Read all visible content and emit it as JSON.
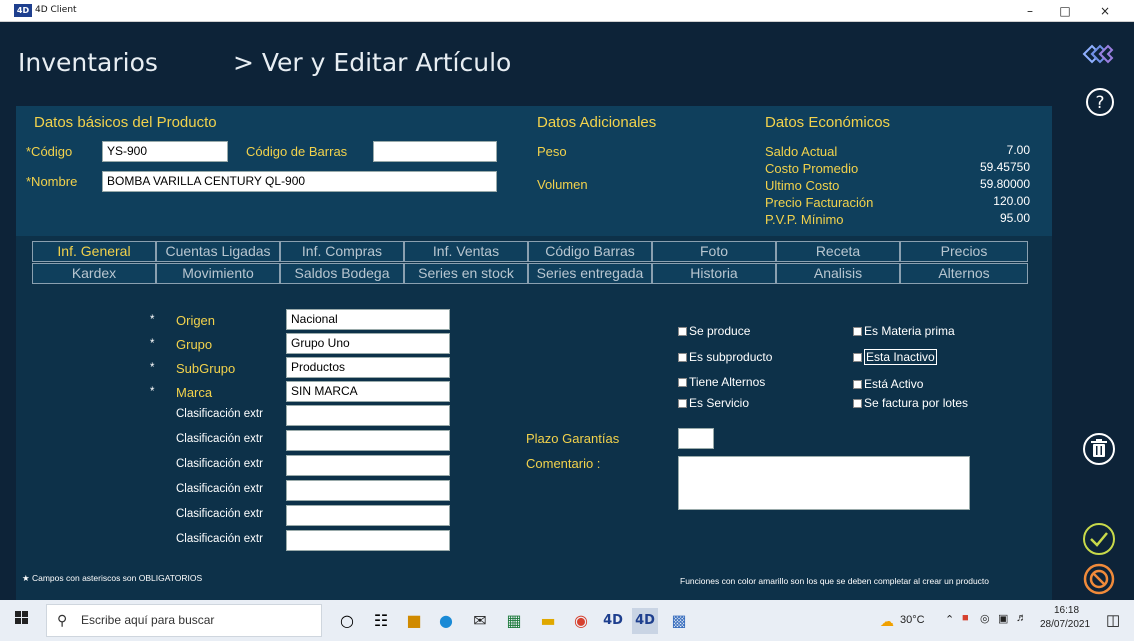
{
  "window": {
    "title": "4D Client",
    "icon_label": "4D"
  },
  "header": {
    "module": "Inventarios",
    "subtitle": "> Ver y Editar Artículo"
  },
  "basic": {
    "section_title": "Datos básicos del Producto",
    "codigo_label": "*Código",
    "codigo_value": "YS-900",
    "barras_label": "Código de Barras",
    "barras_value": "",
    "nombre_label": "*Nombre",
    "nombre_value": "BOMBA VARILLA CENTURY QL-900"
  },
  "additional": {
    "section_title": "Datos Adicionales",
    "peso_label": "Peso",
    "volumen_label": "Volumen"
  },
  "economic": {
    "section_title": "Datos Económicos",
    "rows": [
      {
        "label": "Saldo Actual",
        "value": "7.00"
      },
      {
        "label": "Costo Promedio",
        "value": "59.45750"
      },
      {
        "label": "Ultimo Costo",
        "value": "59.80000"
      },
      {
        "label": "Precio Facturación",
        "value": "120.00"
      },
      {
        "label": "P.V.P. Mínimo",
        "value": "95.00"
      }
    ]
  },
  "tabs_row1": [
    "Inf. General",
    "Cuentas Ligadas",
    "Inf. Compras",
    "Inf. Ventas",
    "Código Barras",
    "Foto",
    "Receta",
    "Precios"
  ],
  "tabs_row2": [
    "Kardex",
    "Movimiento",
    "Saldos Bodega",
    "Series en stock",
    "Series entregada",
    "Historia",
    "Analisis",
    "Alternos"
  ],
  "general": {
    "fields": [
      {
        "label": "Origen",
        "value": "Nacional"
      },
      {
        "label": "Grupo",
        "value": "Grupo Uno"
      },
      {
        "label": "SubGrupo",
        "value": "Productos"
      },
      {
        "label": "Marca",
        "value": "SIN MARCA"
      }
    ],
    "clasif_label": "Clasificación extr",
    "clasif_values": [
      "",
      "",
      "",
      "",
      "",
      ""
    ],
    "plazo_label": "Plazo Garantías",
    "comentario_label": "Comentario :",
    "checks_left": [
      "Se produce",
      "Es subproducto",
      "Tiene Alternos",
      "Es Servicio"
    ],
    "checks_right": [
      "Es Materia prima",
      "Esta Inactivo",
      "Está Activo",
      "Se factura por lotes"
    ]
  },
  "footer": {
    "required_note": "Campos con asteriscos son OBLIGATORIOS",
    "yellow_note": "Funciones con color amarillo son los que se deben completar al crear un producto"
  },
  "taskbar": {
    "search_placeholder": "Escribe aquí para buscar",
    "temperature": "30°C",
    "time": "16:18",
    "date": "28/07/2021"
  },
  "colors": {
    "accent_yellow": "#f2d24c",
    "panel": "#0d3149",
    "background": "#0d2338"
  }
}
